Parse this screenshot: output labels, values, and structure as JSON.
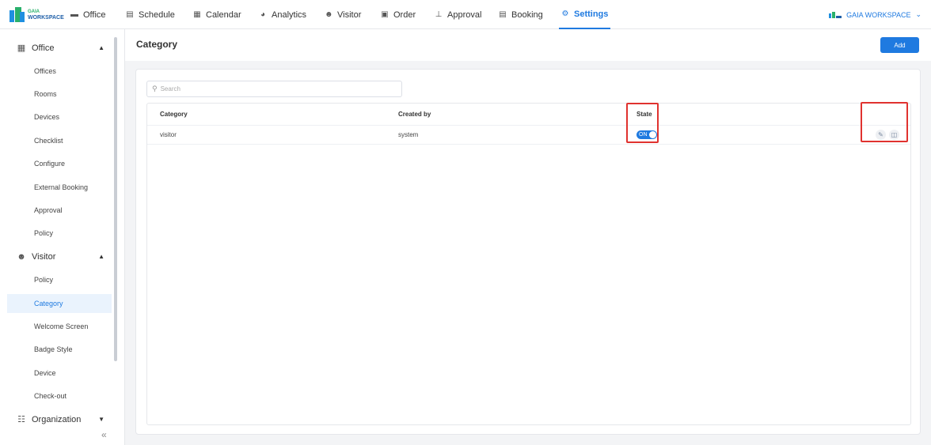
{
  "brand": {
    "logo_line1": "GAIA",
    "logo_line2": "WORKSPACE",
    "workspace_name": "GAIA WORKSPACE",
    "accent": "#1f7ae0"
  },
  "topnav": [
    {
      "label": "Office",
      "icon": "briefcase-icon"
    },
    {
      "label": "Schedule",
      "icon": "schedule-icon"
    },
    {
      "label": "Calendar",
      "icon": "calendar-icon"
    },
    {
      "label": "Analytics",
      "icon": "pie-chart-icon"
    },
    {
      "label": "Visitor",
      "icon": "visitor-icon"
    },
    {
      "label": "Order",
      "icon": "order-icon"
    },
    {
      "label": "Approval",
      "icon": "approval-icon"
    },
    {
      "label": "Booking",
      "icon": "booking-icon"
    },
    {
      "label": "Settings",
      "icon": "gear-icon",
      "active": true
    }
  ],
  "sidebar": {
    "groups": [
      {
        "label": "Office",
        "icon": "office-icon",
        "expanded": true,
        "items": [
          "Offices",
          "Rooms",
          "Devices",
          "Checklist",
          "Configure",
          "External Booking",
          "Approval",
          "Policy"
        ]
      },
      {
        "label": "Visitor",
        "icon": "visitor-icon",
        "expanded": true,
        "items": [
          "Policy",
          "Category",
          "Welcome Screen",
          "Badge Style",
          "Device",
          "Check-out"
        ]
      },
      {
        "label": "Organization",
        "icon": "organization-icon",
        "expanded": false,
        "items": []
      }
    ],
    "active_item": "Category",
    "collapse_glyph": "«"
  },
  "main": {
    "title": "Category",
    "add_label": "Add",
    "search_placeholder": "Search",
    "columns": [
      "Category",
      "Created by",
      "State",
      ""
    ],
    "rows": [
      {
        "category": "visitor",
        "created_by": "system",
        "state": "ON",
        "state_on": true
      }
    ]
  },
  "highlight_color": "#e0322f"
}
